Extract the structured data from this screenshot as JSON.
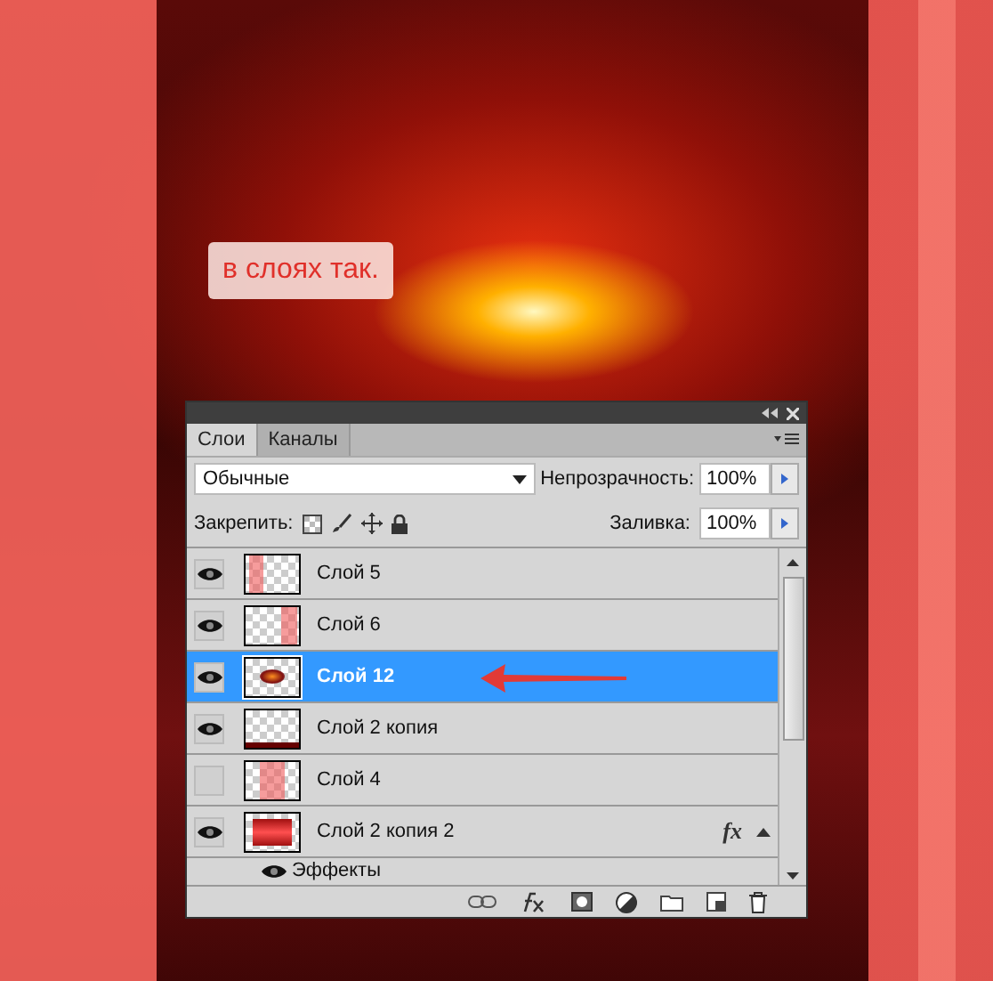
{
  "caption": "в слоях так.",
  "panel": {
    "tabs": [
      {
        "label": "Слои",
        "selected": true
      },
      {
        "label": "Каналы",
        "selected": false
      }
    ],
    "blend_mode": {
      "value": "Обычные"
    },
    "opacity": {
      "label": "Непрозрачность:",
      "value": "100%"
    },
    "lock": {
      "label": "Закрепить:"
    },
    "fill": {
      "label": "Заливка:",
      "value": "100%"
    },
    "layers": [
      {
        "name": "Слой 5",
        "visible": true,
        "selected": false,
        "kind": "left-stripe"
      },
      {
        "name": "Слой 6",
        "visible": true,
        "selected": false,
        "kind": "right-stripe"
      },
      {
        "name": "Слой 12",
        "visible": true,
        "selected": true,
        "kind": "glow"
      },
      {
        "name": "Слой 2 копия",
        "visible": true,
        "selected": false,
        "kind": "bottom-line"
      },
      {
        "name": "Слой 4",
        "visible": false,
        "selected": false,
        "kind": "center-stripe"
      },
      {
        "name": "Слой 2 копия 2",
        "visible": true,
        "selected": false,
        "kind": "red-block",
        "fx": "fx",
        "expanded": true,
        "children": [
          {
            "name": "Эффекты",
            "visible": true
          }
        ]
      }
    ]
  }
}
